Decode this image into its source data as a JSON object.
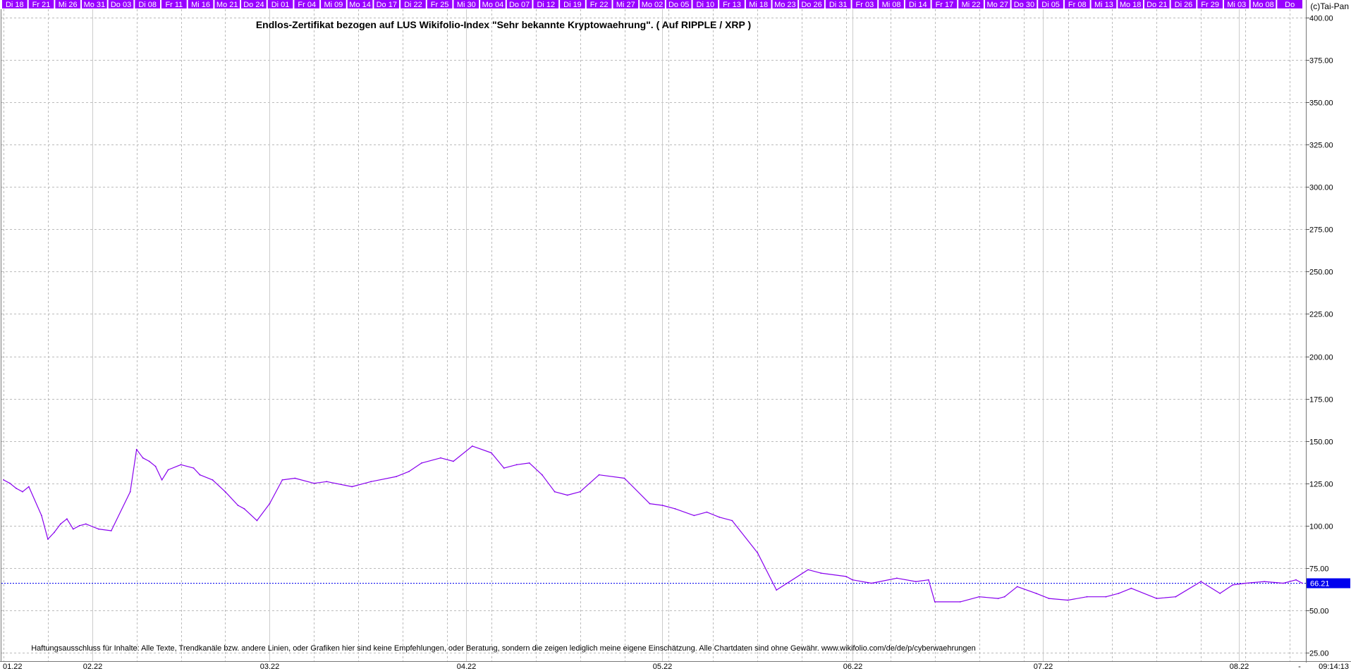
{
  "copyright": "(c)Tai-Pan",
  "title": "Endlos-Zertifikat bezogen auf LUS Wikifolio-Index \"Sehr bekannte Kryptowaehrung\". ( Auf RIPPLE / XRP )",
  "disclaimer": "Haftungsausschluss für Inhalte: Alle Texte, Trendkanäle bzw. andere Linien, oder Grafiken hier sind keine Empfehlungen, oder Beratung, sondern die zeigen lediglich meine eigene Einschätzung. Alle Chartdaten sind ohne Gewähr.  www.wikifolio.com/de/de/p/cyberwaehrungen",
  "timestamp": "09:14:13",
  "bottom_right_mark": "-",
  "day_tabs": [
    "Di 18",
    "Fr 21",
    "Mi 26",
    "Mo 31",
    "Do 03",
    "Di 08",
    "Fr 11",
    "Mi 16",
    "Mo 21",
    "Do 24",
    "Di 01",
    "Fr 04",
    "Mi 09",
    "Mo 14",
    "Do 17",
    "Di 22",
    "Fr 25",
    "Mi 30",
    "Mo 04",
    "Do 07",
    "Di 12",
    "Di 19",
    "Fr 22",
    "Mi 27",
    "Mo 02",
    "Do 05",
    "Di 10",
    "Fr 13",
    "Mi 18",
    "Mo 23",
    "Do 26",
    "Di 31",
    "Fr 03",
    "Mi 08",
    "Di 14",
    "Fr 17",
    "Mi 22",
    "Mo 27",
    "Do 30",
    "Di 05",
    "Fr 08",
    "Mi 13",
    "Mo 18",
    "Do 21",
    "Di 26",
    "Fr 29",
    "Mi 03",
    "Mo 08",
    "Do"
  ],
  "colors": {
    "price_line": "#8800ee",
    "last_price_line": "#0000ee",
    "last_price_tag_bg": "#0000ee",
    "day_tab_bg": "#9900ff",
    "grid": "#bbbbbb"
  },
  "chart_data": {
    "type": "line",
    "title": "Endlos-Zertifikat bezogen auf LUS Wikifolio-Index \"Sehr bekannte Kryptowaehrung\". ( Auf RIPPLE / XRP )",
    "xlabel": "",
    "ylabel": "",
    "ylim": [
      20,
      405
    ],
    "y_ticks": [
      25,
      50,
      75,
      100,
      125,
      150,
      175,
      200,
      225,
      250,
      275,
      300,
      325,
      350,
      375,
      400
    ],
    "y_tick_labels": [
      "25.00",
      "50.00",
      "75.00",
      "100.00",
      "125.00",
      "150.00",
      "175.00",
      "200.00",
      "225.00",
      "250.00",
      "275.00",
      "300.00",
      "325.00",
      "350.00",
      "375.00",
      "400.00"
    ],
    "x_range": [
      "2022-01-18",
      "2022-08-11"
    ],
    "month_ticks": [
      {
        "date": "2022-01-18",
        "label": "01.22"
      },
      {
        "date": "2022-02-01",
        "label": "02.22"
      },
      {
        "date": "2022-03-01",
        "label": "03.22"
      },
      {
        "date": "2022-04-01",
        "label": "04.22"
      },
      {
        "date": "2022-05-02",
        "label": "05.22"
      },
      {
        "date": "2022-06-01",
        "label": "06.22"
      },
      {
        "date": "2022-07-01",
        "label": "07.22"
      },
      {
        "date": "2022-08-01",
        "label": "08.22"
      }
    ],
    "grid": true,
    "last_value": 66.21,
    "last_value_label": "66.21",
    "series": [
      {
        "x": [
          "2022-01-18",
          "2022-01-19",
          "2022-01-20",
          "2022-01-21",
          "2022-01-22",
          "2022-01-24",
          "2022-01-25",
          "2022-01-26",
          "2022-01-27",
          "2022-01-28",
          "2022-01-29",
          "2022-01-30",
          "2022-01-31",
          "2022-02-02",
          "2022-02-04",
          "2022-02-07",
          "2022-02-08",
          "2022-02-09",
          "2022-02-10",
          "2022-02-11",
          "2022-02-12",
          "2022-02-13",
          "2022-02-15",
          "2022-02-17",
          "2022-02-18",
          "2022-02-20",
          "2022-02-22",
          "2022-02-24",
          "2022-02-25",
          "2022-02-27",
          "2022-03-01",
          "2022-03-03",
          "2022-03-05",
          "2022-03-08",
          "2022-03-10",
          "2022-03-14",
          "2022-03-17",
          "2022-03-21",
          "2022-03-23",
          "2022-03-25",
          "2022-03-28",
          "2022-03-30",
          "2022-04-02",
          "2022-04-05",
          "2022-04-07",
          "2022-04-09",
          "2022-04-11",
          "2022-04-13",
          "2022-04-15",
          "2022-04-17",
          "2022-04-19",
          "2022-04-22",
          "2022-04-26",
          "2022-04-30",
          "2022-05-02",
          "2022-05-04",
          "2022-05-07",
          "2022-05-09",
          "2022-05-11",
          "2022-05-13",
          "2022-05-17",
          "2022-05-20",
          "2022-05-25",
          "2022-05-27",
          "2022-05-31",
          "2022-06-01",
          "2022-06-04",
          "2022-06-08",
          "2022-06-11",
          "2022-06-13",
          "2022-06-14",
          "2022-06-18",
          "2022-06-21",
          "2022-06-24",
          "2022-06-25",
          "2022-06-27",
          "2022-06-30",
          "2022-07-02",
          "2022-07-05",
          "2022-07-08",
          "2022-07-11",
          "2022-07-13",
          "2022-07-15",
          "2022-07-19",
          "2022-07-22",
          "2022-07-26",
          "2022-07-29",
          "2022-07-31",
          "2022-08-02",
          "2022-08-05",
          "2022-08-08",
          "2022-08-10",
          "2022-08-11"
        ],
        "y": [
          127,
          125,
          122,
          120,
          123,
          106,
          92,
          96,
          101,
          104,
          98,
          100,
          101,
          98,
          97,
          120,
          145,
          140,
          138,
          135,
          127,
          133,
          136,
          134,
          130,
          127,
          120,
          112,
          110,
          103,
          113,
          127,
          128,
          125,
          126,
          123,
          126,
          129,
          132,
          137,
          140,
          138,
          147,
          143,
          134,
          136,
          137,
          130,
          120,
          118,
          120,
          130,
          128,
          113,
          112,
          110,
          106,
          108,
          105,
          103,
          84,
          62,
          74,
          72,
          70,
          68,
          66,
          69,
          67,
          68,
          55,
          55,
          58,
          57,
          58,
          64,
          60,
          57,
          56,
          58,
          58,
          60,
          63,
          57,
          58,
          67,
          60,
          65,
          66,
          67,
          66,
          68,
          66
        ]
      }
    ]
  }
}
